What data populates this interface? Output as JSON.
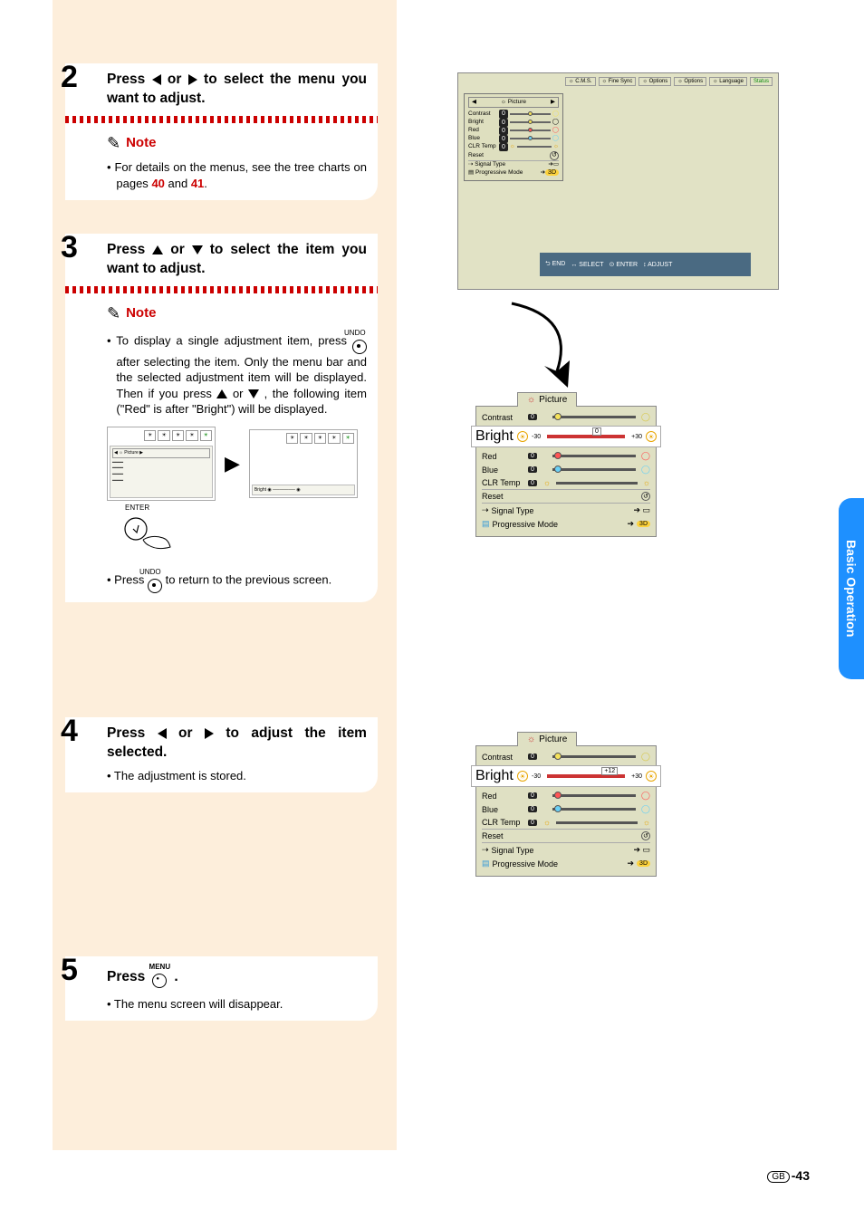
{
  "sideTab": "Basic Operation",
  "pageNum": "-43",
  "gb": "GB",
  "steps": {
    "s2": {
      "num": "2",
      "title_a": "Press ",
      "title_b": " or ",
      "title_c": " to select the menu you want to adjust.",
      "note": "Note",
      "bullet_a": "• For details on the menus, see the tree charts on pages ",
      "p1": "40",
      "and": " and ",
      "p2": "41",
      "period": "."
    },
    "s3": {
      "num": "3",
      "title_a": "Press ",
      "title_b": " or ",
      "title_c": " to select the item you want to adjust.",
      "note": "Note",
      "b1_a": "• To display a single adjustment item, press ",
      "b1_b": " after selecting the item. Only the menu bar and the selected adjustment item will be displayed. Then if you press ",
      "b1_c": " or ",
      "b1_d": ", the following item (\"Red\" is after \"Bright\") will be displayed.",
      "enter_label": "ENTER",
      "b2_a": "• Press ",
      "b2_b": " to return to the previous screen.",
      "undo_label": "UNDO"
    },
    "s4": {
      "num": "4",
      "title_a": "Press ",
      "title_b": " or ",
      "title_c": " to adjust the item selected.",
      "bullet": "• The adjustment is stored."
    },
    "s5": {
      "num": "5",
      "title_a": "Press ",
      "title_b": ".",
      "menu_label": "MENU",
      "bullet": "• The menu screen will disappear."
    }
  },
  "osd": {
    "tabs": [
      "C.M.S.",
      "Fine Sync",
      "Options",
      "Options",
      "Language",
      "Status"
    ],
    "picture": "Picture",
    "hints": {
      "end": "END",
      "enter": "ENTER",
      "select": "SELECT",
      "adjust": "ADJUST"
    },
    "rows": {
      "contrast": "Contrast",
      "bright": "Bright",
      "red": "Red",
      "blue": "Blue",
      "clrtemp": "CLR Temp",
      "reset": "Reset",
      "signal": "Signal Type",
      "prog": "Progressive Mode",
      "zero": "0",
      "neg30": "-30",
      "pos30": "+30",
      "plus12": "+12",
      "threeD": "3D"
    }
  }
}
